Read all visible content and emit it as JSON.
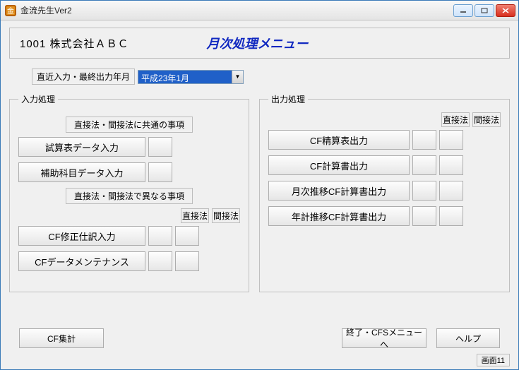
{
  "window": {
    "title": "金流先生Ver2"
  },
  "header": {
    "company": "1001  株式会社ＡＢＣ",
    "screen_title": "月次処理メニュー"
  },
  "date": {
    "label": "直近入力・最終出力年月",
    "value": "平成23年1月"
  },
  "input_group": {
    "legend": "入力処理",
    "section1_label": "直接法・間接法に共通の事項",
    "btn_trial_balance": "試算表データ入力",
    "btn_sub_account": "補助科目データ入力",
    "section2_label": "直接法・間接法で異なる事項",
    "method_direct": "直接法",
    "method_indirect": "間接法",
    "btn_cf_adjust": "CF修正仕訳入力",
    "btn_cf_maint": "CFデータメンテナンス"
  },
  "output_group": {
    "legend": "出力処理",
    "method_direct": "直接法",
    "method_indirect": "間接法",
    "btn_cf_worksheet": "CF精算表出力",
    "btn_cf_statement": "CF計算書出力",
    "btn_monthly_cf": "月次推移CF計算書出力",
    "btn_annual_cf": "年計推移CF計算書出力"
  },
  "footer": {
    "btn_cf_total": "CF集計",
    "btn_exit": "終了・CFSメニューへ",
    "btn_help": "ヘルプ"
  },
  "status": "画面11"
}
